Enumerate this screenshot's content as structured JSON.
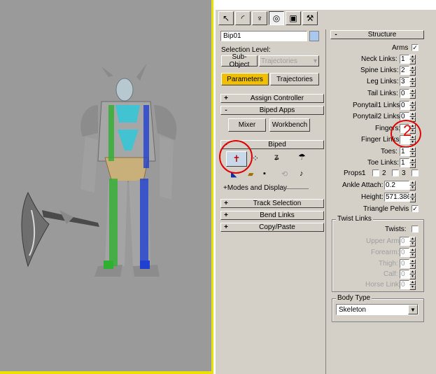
{
  "command_tabs": [
    "create-icon",
    "modify-icon",
    "hierarchy-icon",
    "motion-icon",
    "display-icon",
    "utilities-icon"
  ],
  "object_name": "Bip01",
  "selection_level_label": "Selection Level:",
  "sub_object_label": "Sub-Object",
  "sub_object_dropdown": "Trajectories",
  "parameters_label": "Parameters",
  "trajectories_label": "Trajectories",
  "rollouts": {
    "assign_controller": "Assign Controller",
    "biped_apps": "Biped Apps",
    "biped": "Biped",
    "track_selection": "Track Selection",
    "bend_links": "Bend Links",
    "copy_paste": "Copy/Paste",
    "structure": "Structure"
  },
  "mixer_label": "Mixer",
  "workbench_label": "Workbench",
  "modes_label": "+Modes and Display",
  "structure": {
    "arms_label": "Arms",
    "arms_checked": "✓",
    "neck_links_label": "Neck Links:",
    "neck_links": "1",
    "spine_links_label": "Spine Links:",
    "spine_links": "2",
    "leg_links_label": "Leg Links:",
    "leg_links": "3",
    "tail_links_label": "Tail Links:",
    "tail_links": "0",
    "ponytail1_label": "Ponytail1 Links:",
    "ponytail1": "0",
    "ponytail2_label": "Ponytail2 Links:",
    "ponytail2": "0",
    "fingers_label": "Fingers:",
    "fingers": "",
    "finger_links_label": "Finger Links:",
    "finger_links": "",
    "toes_label": "Toes:",
    "toes": "1",
    "toe_links_label": "Toe Links:",
    "toe_links": "1",
    "props_label": "Props:",
    "prop1": "1",
    "prop2": "2",
    "prop3": "3",
    "ankle_attach_label": "Ankle Attach:",
    "ankle_attach": "0.2",
    "height_label": "Height:",
    "height": "571.386",
    "triangle_pelvis_label": "Triangle Pelvis",
    "triangle_pelvis_checked": "✓"
  },
  "annotation_number": "2",
  "twist_links": {
    "title": "Twist Links",
    "twists_label": "Twists:",
    "upper_arm_label": "Upper Arm:",
    "upper_arm": "0",
    "forearm_label": "Forearm:",
    "forearm": "0",
    "thigh_label": "Thigh:",
    "thigh": "0",
    "calf_label": "Calf:",
    "calf": "0",
    "horse_link_label": "Horse Link:",
    "horse_link": "0"
  },
  "body_type": {
    "title": "Body Type",
    "value": "Skeleton"
  },
  "colors": {
    "viewport_bg": "#9a9a9a",
    "viewport_border": "#e8e000",
    "panel_bg": "#d4d0c8",
    "active_button": "#f0c000",
    "annotation_red": "#e00000",
    "name_swatch": "#a8c8f0"
  }
}
